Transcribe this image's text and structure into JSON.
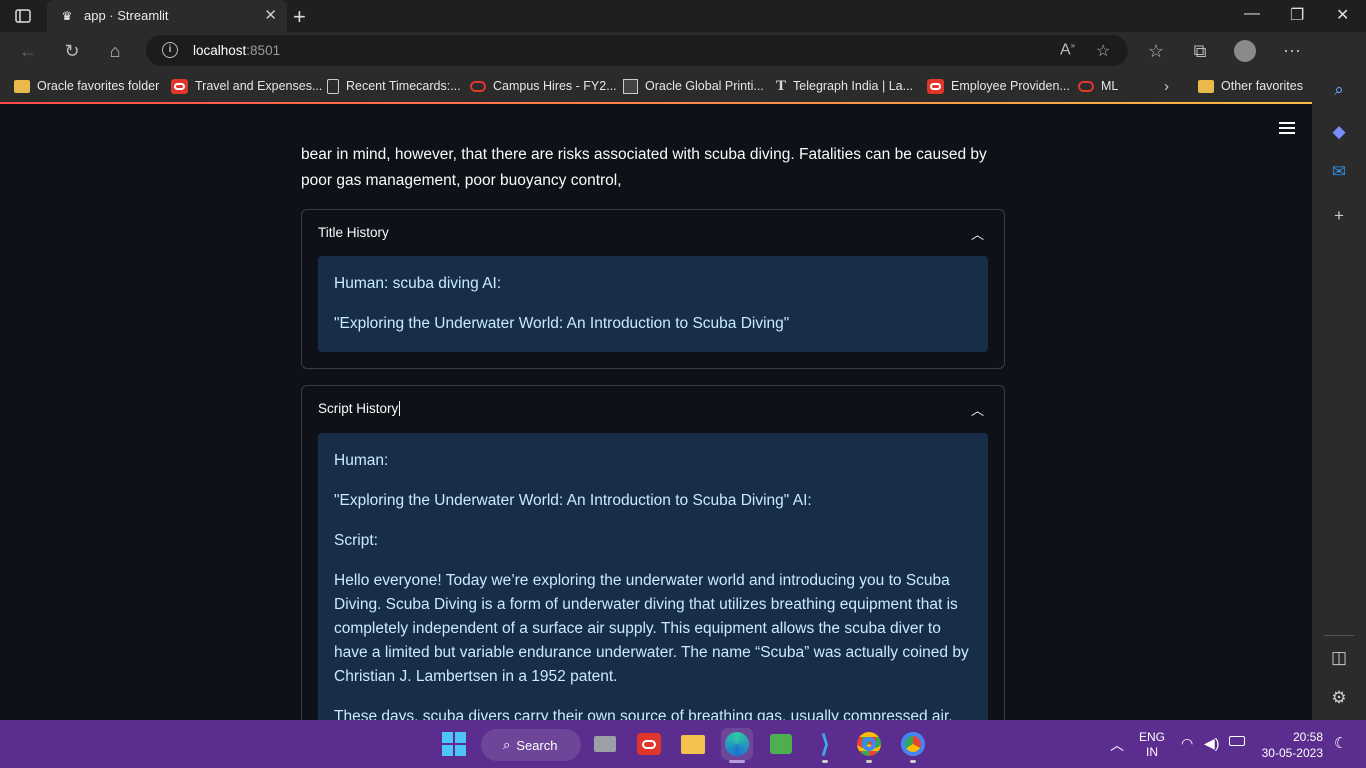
{
  "browser": {
    "tab_title": "app · Streamlit",
    "url_host": "localhost",
    "url_port": ":8501",
    "favorites": [
      {
        "label": "Oracle favorites folder",
        "icon": "folder-icon"
      },
      {
        "label": "Travel and Expenses...",
        "icon": "oracle-icon"
      },
      {
        "label": "Recent Timecards:...",
        "icon": "document-icon"
      },
      {
        "label": "Campus Hires - FY2...",
        "icon": "oracle-ring-icon"
      },
      {
        "label": "Oracle Global Printi...",
        "icon": "printer-icon"
      },
      {
        "label": "Telegraph India | La...",
        "icon": "telegraph-icon"
      },
      {
        "label": "Employee Providen...",
        "icon": "oracle-icon"
      },
      {
        "label": "ML",
        "icon": "oracle-ring-icon"
      }
    ],
    "other_favorites": "Other favorites"
  },
  "app": {
    "lead_text": "bear in mind, however, that there are risks associated with scuba diving. Fatalities can be caused by poor gas management, poor buoyancy control,",
    "title_history": {
      "label": "Title History",
      "lines": [
        "Human: scuba diving AI:",
        "\"Exploring the Underwater World: An Introduction to Scuba Diving\""
      ]
    },
    "script_history": {
      "label": "Script History",
      "lines": [
        "Human:",
        "\"Exploring the Underwater World: An Introduction to Scuba Diving\" AI:",
        "Script:",
        "Hello everyone! Today we’re exploring the underwater world and introducing you to Scuba Diving. Scuba Diving is a form of underwater diving that utilizes breathing equipment that is completely independent of a surface air supply. This equipment allows the scuba diver to have a limited but variable endurance underwater. The name “Scuba” was actually coined by Christian J. Lambertsen in a 1952 patent.",
        "These days, scuba divers carry their own source of breathing gas, usually compressed air, which"
      ]
    }
  },
  "taskbar": {
    "search_label": "Search",
    "lang_top": "ENG",
    "lang_bottom": "IN",
    "time": "20:58",
    "date": "30-05-2023"
  },
  "colors": {
    "app_bg": "#0e1117",
    "info_bg": "#172d48",
    "info_text": "#c7ebff",
    "taskbar": "#5b2d8e"
  }
}
